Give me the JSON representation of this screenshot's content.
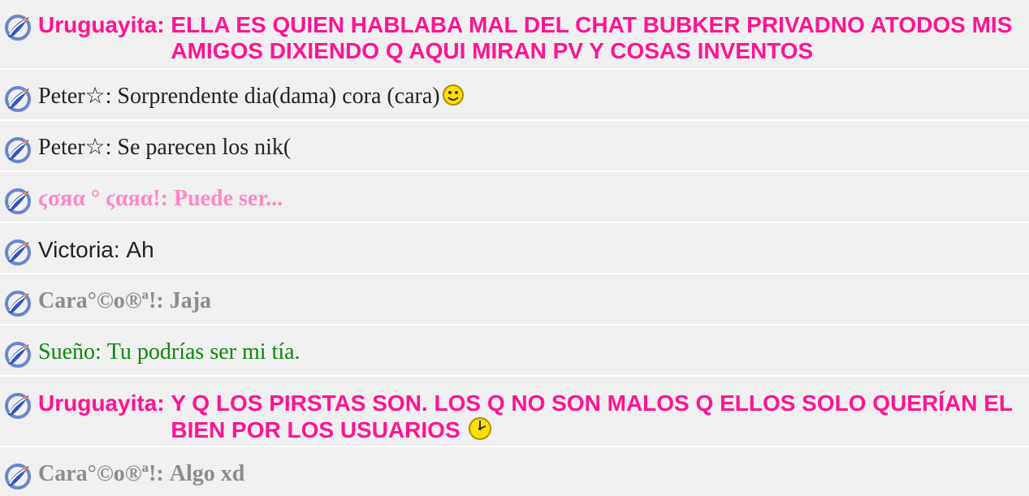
{
  "messages": [
    {
      "name": "Uruguayita",
      "text": "ELLA ES QUIEN HABLABA MAL DEL CHAT BUBKER PRIVADNO ATODOS MIS AMIGOS DIXIENDO Q AQUI MIRAN PV Y COSAS INVENTOS",
      "color": "#ff1493",
      "style": "sans-bold",
      "emoji": ""
    },
    {
      "name": "Peter☆",
      "text": "Sorprendente dia(dama) cora (cara)",
      "color": "#222222",
      "style": "serif",
      "emoji": "smiley-icon"
    },
    {
      "name": "Peter☆",
      "text": "Se parecen los nik(",
      "color": "#222222",
      "style": "serif",
      "emoji": ""
    },
    {
      "name": "ϛσяα ° ϛαяα!",
      "text": "Puede ser...",
      "color": "#ff88c8",
      "style": "serif-bold",
      "emoji": ""
    },
    {
      "name": "Victoria",
      "text": "Ah",
      "color": "#222222",
      "style": "sans",
      "emoji": ""
    },
    {
      "name": "Cara°©o®ª!",
      "text": "Jaja",
      "color": "#8c8c8c",
      "style": "serif-bold",
      "emoji": ""
    },
    {
      "name": "Sueño",
      "text": "Tu podrías ser mi tía.",
      "color": "#0a8a0a",
      "style": "serif",
      "emoji": ""
    },
    {
      "name": "Uruguayita",
      "text": "Y Q LOS PIRSTAS SON. LOS Q NO SON MALOS Q ELLOS SOLO QUERÍAN EL BIEN POR LOS USUARIOS",
      "color": "#ff1493",
      "style": "sans-bold",
      "emoji": "clock-smiley-icon"
    },
    {
      "name": "Cara°©o®ª!",
      "text": "Algo xd",
      "color": "#8c8c8c",
      "style": "serif-bold",
      "emoji": ""
    }
  ]
}
